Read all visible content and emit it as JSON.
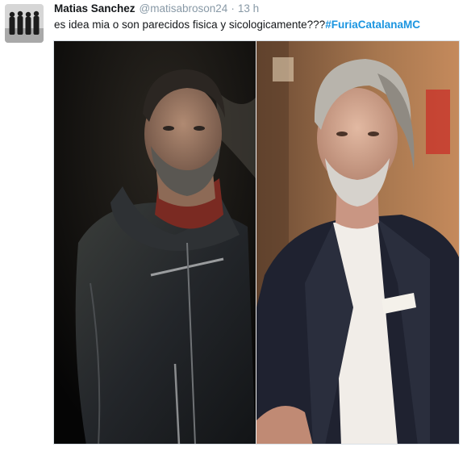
{
  "tweet": {
    "author_name": "Matias Sanchez",
    "author_handle": "@matisabroson24",
    "separator": "·",
    "timestamp": "13 h",
    "text": "es idea mia o son parecidos fisica y sicologicamente???",
    "hashtag": "#FuriaCatalanaMC"
  },
  "media": {
    "left_photo": "photo",
    "right_photo": "photo"
  }
}
